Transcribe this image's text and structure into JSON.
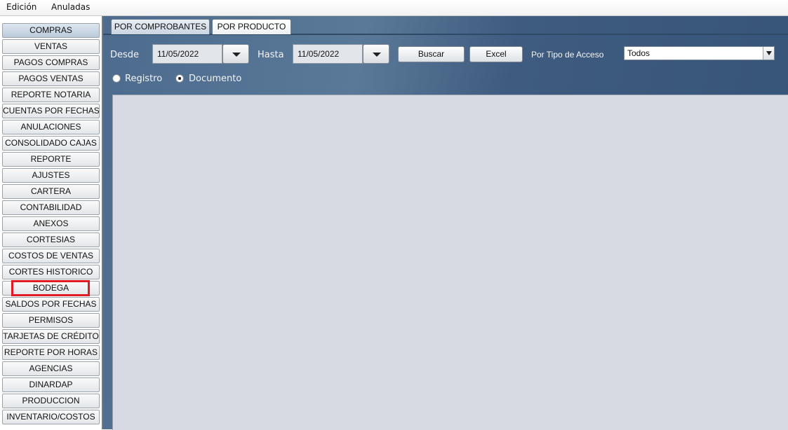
{
  "menu": [
    "Edición",
    "Anuladas"
  ],
  "sidebar": {
    "items": [
      "COMPRAS",
      "VENTAS",
      "PAGOS COMPRAS",
      "PAGOS VENTAS",
      "REPORTE NOTARIA",
      "CUENTAS POR FECHAS",
      "ANULACIONES",
      "CONSOLIDADO CAJAS",
      "REPORTE",
      "AJUSTES",
      "CARTERA",
      "CONTABILIDAD",
      "ANEXOS",
      "CORTESIAS",
      "COSTOS DE VENTAS",
      "CORTES HISTORICO",
      "BODEGA",
      "SALDOS POR FECHAS",
      "PERMISOS",
      "TARJETAS DE CRÉDITO",
      "REPORTE POR HORAS",
      "AGENCIAS",
      "DINARDAP",
      "PRODUCCION",
      "INVENTARIO/COSTOS"
    ]
  },
  "tabs": [
    "POR COMPROBANTES",
    "POR PRODUCTO"
  ],
  "filters": {
    "desde_label": "Desde",
    "desde_value": "11/05/2022",
    "hasta_label": "Hasta",
    "hasta_value": "11/05/2022",
    "buscar_label": "Buscar",
    "excel_label": "Excel",
    "tipo_acceso_label": "Por Tipo de Acceso",
    "tipo_acceso_value": "Todos"
  },
  "radios": {
    "registro_label": "Registro",
    "documento_label": "Documento",
    "selected": "Documento"
  },
  "colors": {
    "highlight": "#e01b24",
    "panel_blue": "#4d6b8e",
    "content_bg": "#d7dae2"
  }
}
